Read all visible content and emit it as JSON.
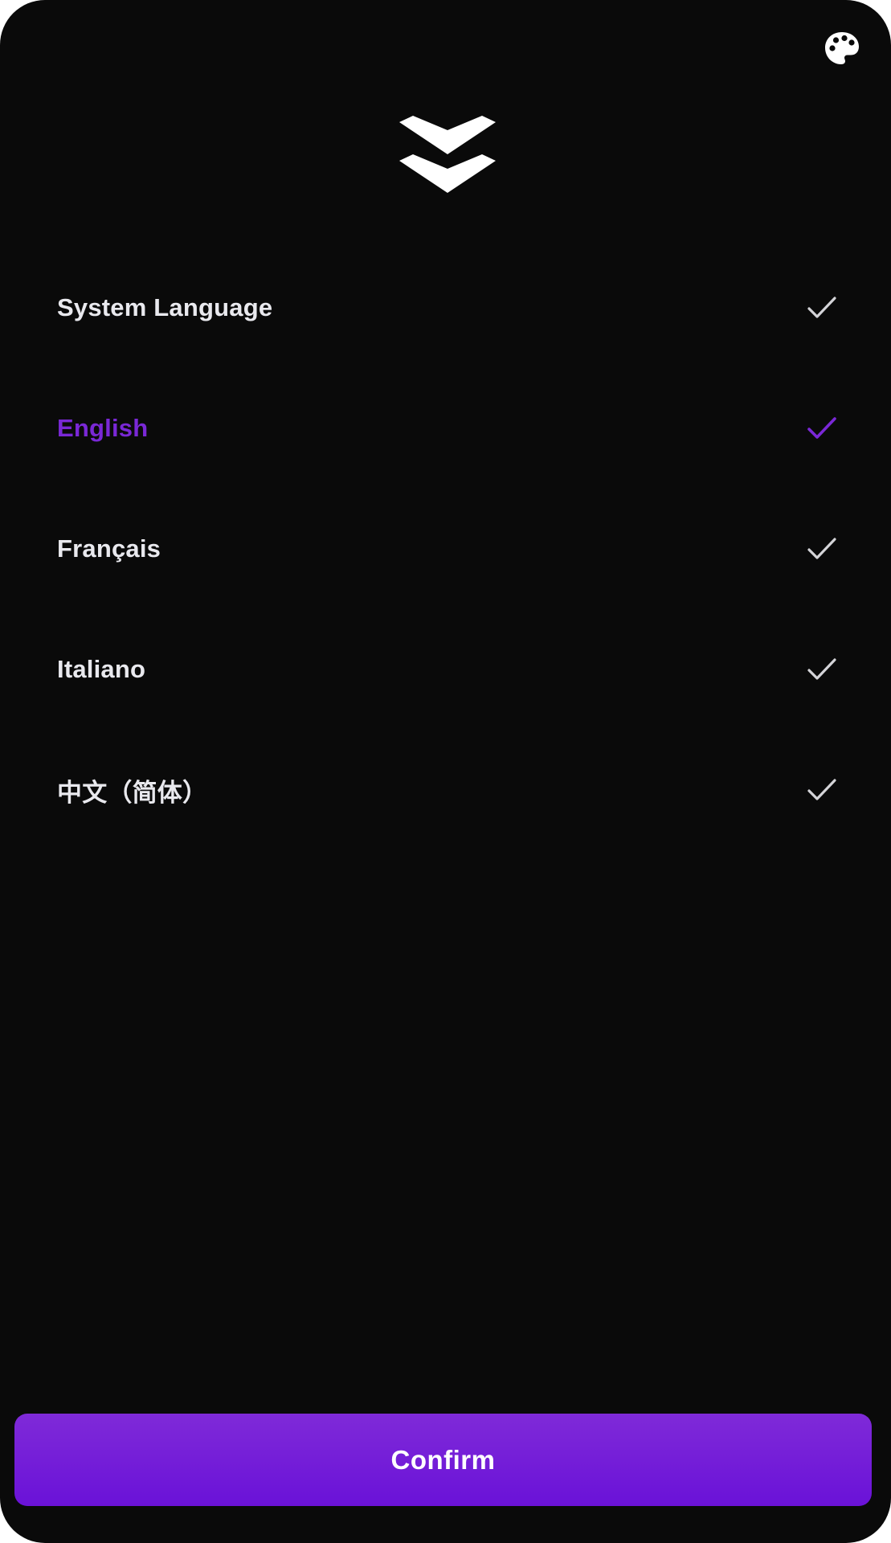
{
  "header": {
    "theme_icon": "palette-icon",
    "logo_icon": "layers-logo-icon"
  },
  "languages": [
    {
      "label": "System Language",
      "selected": false
    },
    {
      "label": "English",
      "selected": true
    },
    {
      "label": "Français",
      "selected": false
    },
    {
      "label": "Italiano",
      "selected": false
    },
    {
      "label": "中文（简体）",
      "selected": false
    }
  ],
  "footer": {
    "confirm_label": "Confirm"
  },
  "colors": {
    "background": "#0a0a0a",
    "accent": "#7a28d6",
    "text": "#e9e9ee",
    "check_default": "#d4d4d8"
  }
}
